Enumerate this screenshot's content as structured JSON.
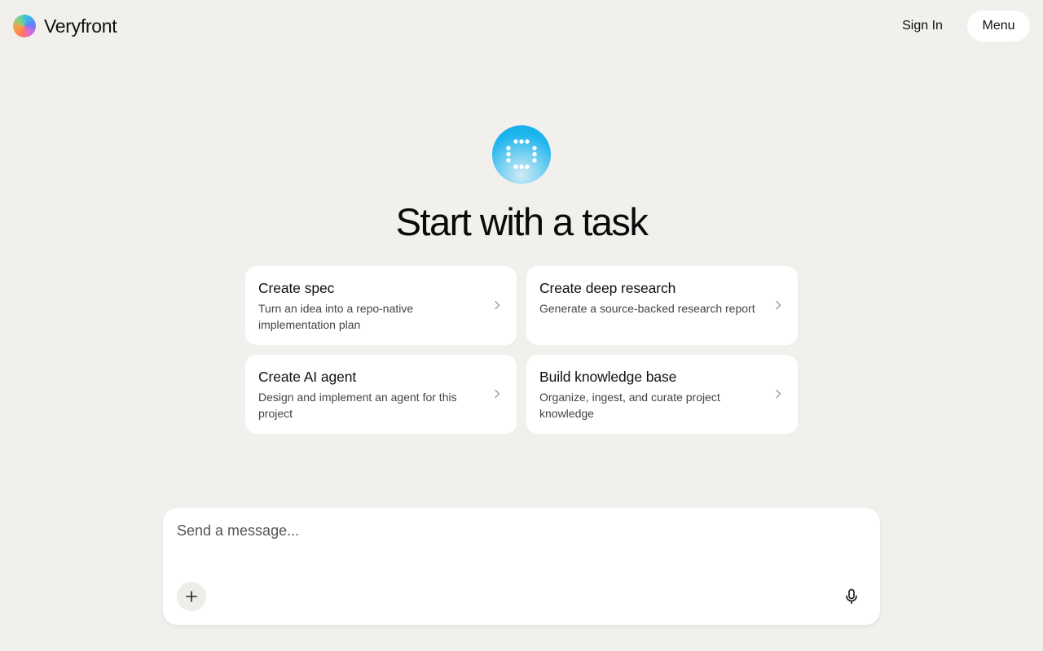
{
  "header": {
    "brand_name": "Veryfront",
    "brand_logo_icon": "gradient-orb-logo",
    "sign_in_label": "Sign In",
    "menu_label": "Menu"
  },
  "hero": {
    "icon": "dotted-square-icon",
    "accent_color": "#1fb5ee",
    "title": "Start with a task"
  },
  "tasks": [
    {
      "title": "Create spec",
      "description": "Turn an idea into a repo-native implementation plan",
      "icon": "chevron-right-icon"
    },
    {
      "title": "Create deep research",
      "description": "Generate a source-backed research report",
      "icon": "chevron-right-icon"
    },
    {
      "title": "Create AI agent",
      "description": "Design and implement an agent for this project",
      "icon": "chevron-right-icon"
    },
    {
      "title": "Build knowledge base",
      "description": "Organize, ingest, and curate project knowledge",
      "icon": "chevron-right-icon"
    }
  ],
  "composer": {
    "value": "",
    "placeholder": "Send a message...",
    "attach_icon": "plus-icon",
    "voice_icon": "microphone-icon"
  },
  "colors": {
    "background": "#f1f0ec",
    "surface": "#ffffff",
    "text": "#111111"
  }
}
